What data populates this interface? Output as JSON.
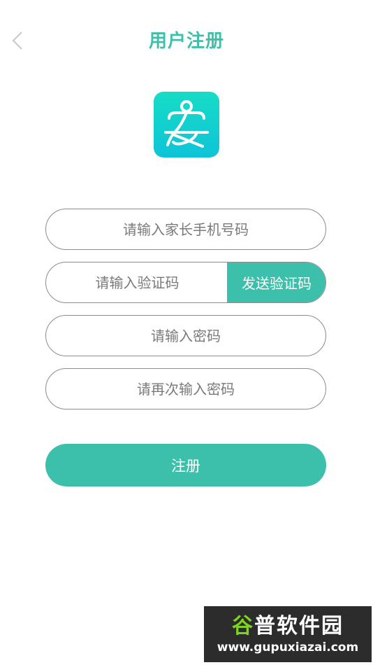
{
  "header": {
    "title": "用户注册",
    "back_icon": "chevron-left-icon"
  },
  "logo": {
    "icon": "an-character-logo",
    "colors": [
      "#16dcc5",
      "#0ec4d8"
    ]
  },
  "form": {
    "phone_placeholder": "请输入家长手机号码",
    "code_placeholder": "请输入验证码",
    "send_code_label": "发送验证码",
    "password_placeholder": "请输入密码",
    "confirm_password_placeholder": "请再次输入密码",
    "submit_label": "注册"
  },
  "watermark": {
    "title_first": "谷",
    "title_rest": "普软件园",
    "url": "www.gupuxiazai.com"
  },
  "colors": {
    "accent": "#3cc0ab",
    "border": "#8c8c8c",
    "placeholder": "#7a7a7a"
  }
}
